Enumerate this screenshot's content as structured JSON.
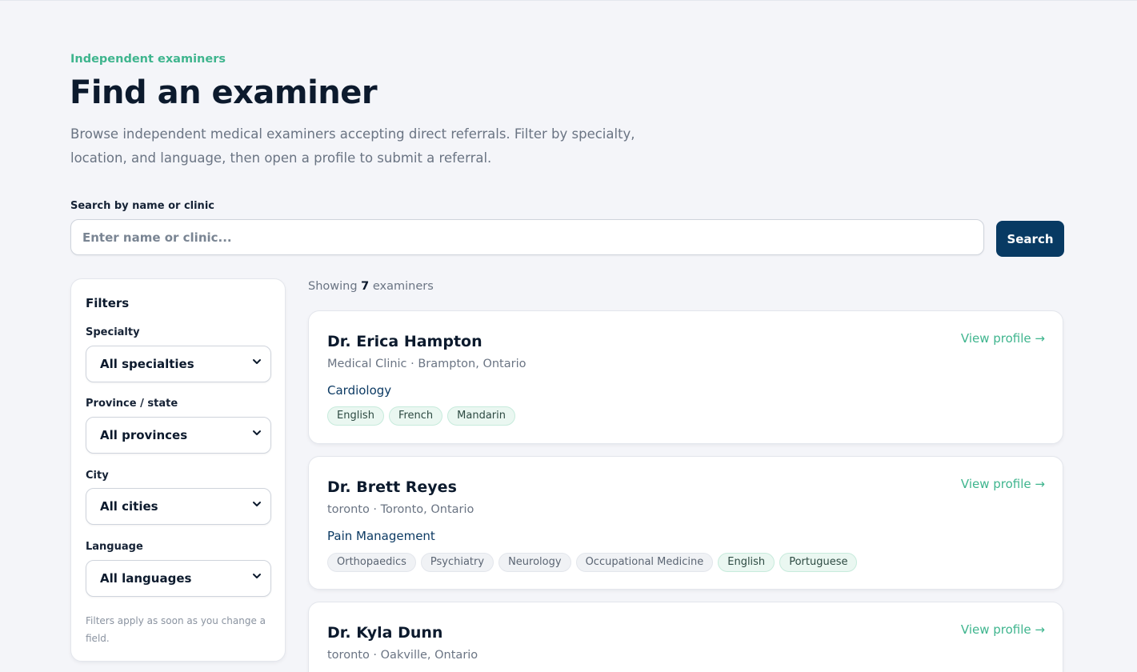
{
  "header": {
    "eyebrow": "Independent examiners",
    "title": "Find an examiner",
    "lead": "Browse independent medical examiners accepting direct referrals. Filter by specialty, location, and language, then open a profile to submit a referral."
  },
  "search": {
    "label": "Search by name or clinic",
    "placeholder": "Enter name or clinic...",
    "value": "",
    "button": "Search"
  },
  "filters": {
    "title": "Filters",
    "specialty": {
      "label": "Specialty",
      "value": "All specialties"
    },
    "province": {
      "label": "Province / state",
      "value": "All provinces"
    },
    "city": {
      "label": "City",
      "value": "All cities"
    },
    "language": {
      "label": "Language",
      "value": "All languages"
    },
    "note": "Filters apply as soon as you change a field."
  },
  "results": {
    "showing_prefix": "Showing",
    "count": "7",
    "showing_suffix": "examiners",
    "view_label": "View profile →",
    "examiners": [
      {
        "name": "Dr. Erica Hampton",
        "location": "Medical Clinic · Brampton, Ontario",
        "specialty": "Cardiology",
        "tags": [
          {
            "text": "English",
            "kind": "language"
          },
          {
            "text": "French",
            "kind": "language"
          },
          {
            "text": "Mandarin",
            "kind": "language"
          }
        ]
      },
      {
        "name": "Dr. Brett Reyes",
        "location": "toronto · Toronto, Ontario",
        "specialty": "Pain Management",
        "tags": [
          {
            "text": "Orthopaedics",
            "kind": "specialty"
          },
          {
            "text": "Psychiatry",
            "kind": "specialty"
          },
          {
            "text": "Neurology",
            "kind": "specialty"
          },
          {
            "text": "Occupational Medicine",
            "kind": "specialty"
          },
          {
            "text": "English",
            "kind": "language"
          },
          {
            "text": "Portuguese",
            "kind": "language"
          }
        ]
      },
      {
        "name": "Dr. Kyla Dunn",
        "location": "toronto · Oakville, Ontario",
        "specialty": "",
        "tags": []
      }
    ]
  },
  "colors": {
    "accent": "#3fb58e",
    "primary": "#083a63",
    "background": "#f4f5f9"
  }
}
